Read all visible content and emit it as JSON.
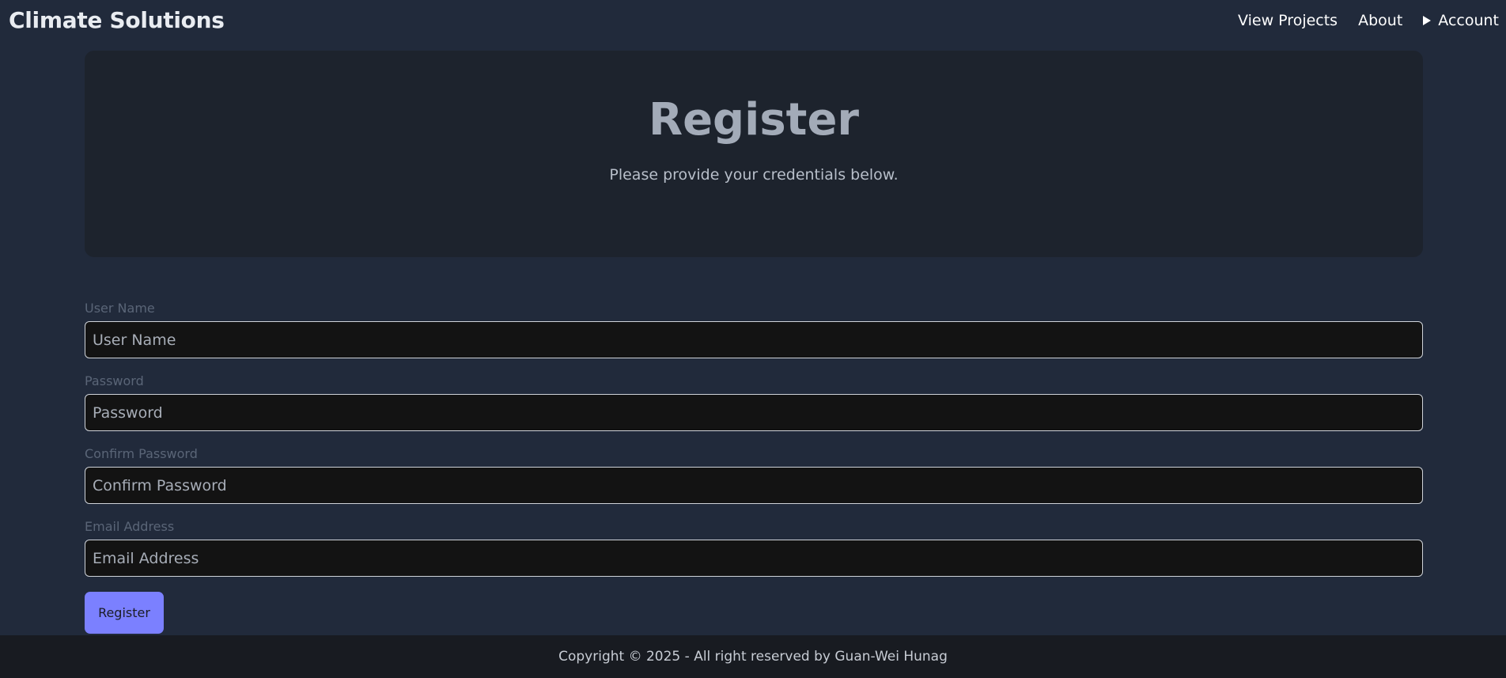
{
  "navbar": {
    "brand": "Climate Solutions",
    "links": [
      {
        "label": "View Projects"
      },
      {
        "label": "About"
      },
      {
        "label": "Account"
      }
    ]
  },
  "hero": {
    "title": "Register",
    "subtitle": "Please provide your credentials below."
  },
  "form": {
    "fields": [
      {
        "label": "User Name",
        "placeholder": "User Name",
        "value": ""
      },
      {
        "label": "Password",
        "placeholder": "Password",
        "value": ""
      },
      {
        "label": "Confirm Password",
        "placeholder": "Confirm Password",
        "value": ""
      },
      {
        "label": "Email Address",
        "placeholder": "Email Address",
        "value": ""
      }
    ],
    "submit_label": "Register"
  },
  "footer": {
    "text": "Copyright © 2025 - All right reserved by Guan-Wei Hunag"
  },
  "colors": {
    "background": "#212a3b",
    "hero_background": "#1d232d",
    "accent": "#7b80ff",
    "footer_background": "#181b21"
  }
}
